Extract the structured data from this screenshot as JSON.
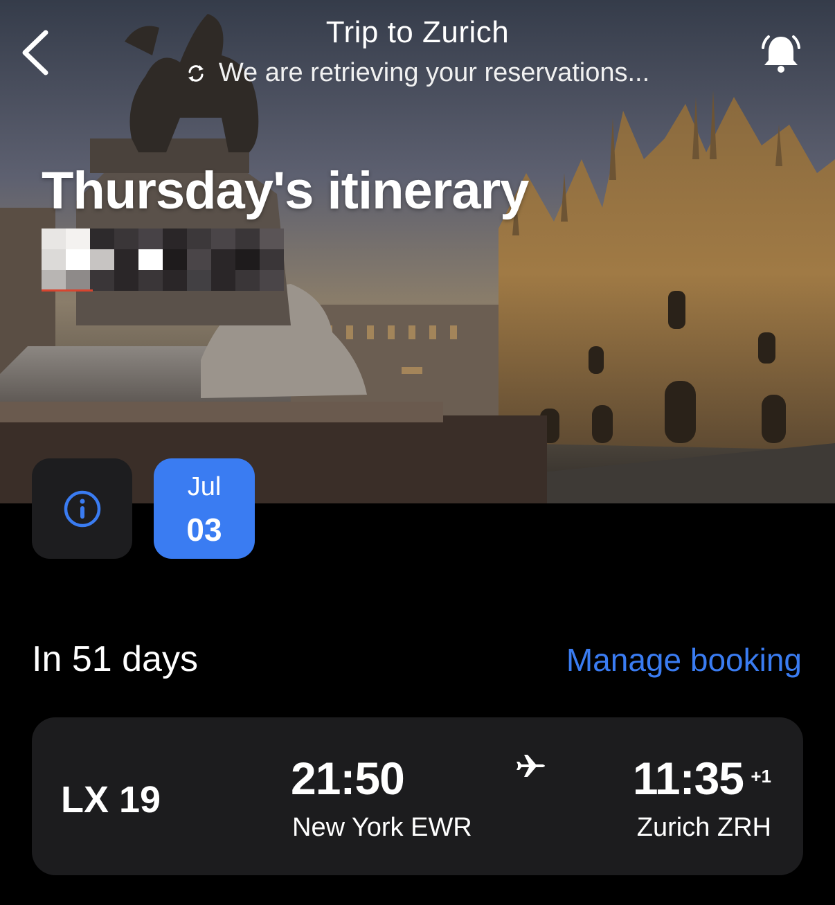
{
  "header": {
    "title": "Trip to Zurich",
    "status": "We are retrieving your reservations...",
    "back_icon": "chevron-left-icon",
    "status_icon": "refresh-icon",
    "notification_icon": "bell-icon"
  },
  "hero": {
    "heading": "Thursday's itinerary",
    "redacted_subtitle": true
  },
  "date_selector": {
    "info_icon": "info-icon",
    "selected_month": "Jul",
    "selected_day": "03"
  },
  "countdown": {
    "label": "In 51 days",
    "action": "Manage booking"
  },
  "flight": {
    "number": "LX 19",
    "departure_time": "21:50",
    "departure_airport": "New York EWR",
    "arrival_time": "11:35",
    "arrival_day_offset": "+1",
    "arrival_airport": "Zurich ZRH",
    "icon": "airplane-icon"
  },
  "colors": {
    "accent": "#3a7cf2",
    "card": "#1c1c1e",
    "background": "#000000"
  }
}
